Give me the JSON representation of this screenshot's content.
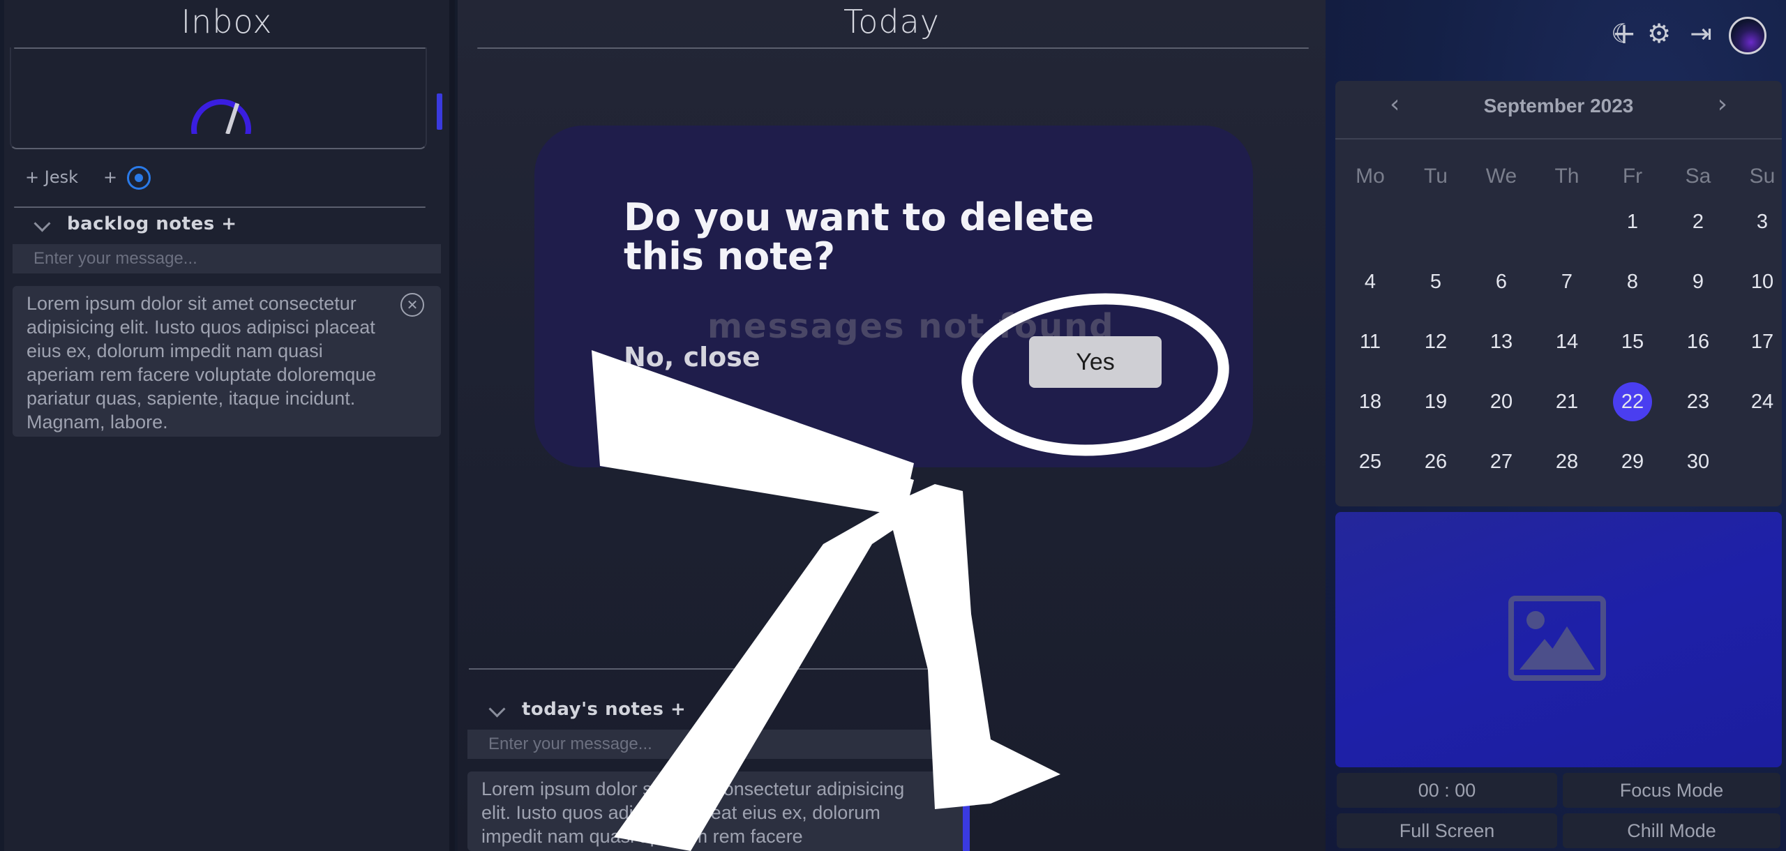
{
  "inbox": {
    "title": "Inbox",
    "add_items": [
      {
        "label": "+ Jesk"
      },
      {
        "label": "+"
      }
    ],
    "backlog": {
      "heading": "backlog notes +",
      "placeholder": "Enter your message...",
      "note": "Lorem ipsum dolor sit amet consectetur adipisicing elit. Iusto quos adipisci placeat eius ex, dolorum impedit nam quasi aperiam rem facere voluptate doloremque pariatur quas, sapiente, itaque incidunt. Magnam, labore."
    }
  },
  "today": {
    "title": "Today",
    "notes_heading": "today's notes +",
    "placeholder": "Enter your message...",
    "note": "Lorem ipsum dolor sit amet consectetur adipisicing elit. Iusto quos adipisci placeat eius ex, dolorum impedit nam quasi aperiam rem facere"
  },
  "modal": {
    "title": "Do you want to delete this note?",
    "background_text": "messages not found",
    "no_label": "No, close",
    "yes_label": "Yes"
  },
  "topbar": {
    "icons": [
      "moon-icon",
      "plus-icon",
      "gear-icon",
      "logout-icon",
      "avatar"
    ]
  },
  "calendar": {
    "month": "September 2023",
    "weekdays": [
      "Mo",
      "Tu",
      "We",
      "Th",
      "Fr",
      "Sa",
      "Su"
    ],
    "weeks": [
      [
        "",
        "",
        "",
        "",
        "1",
        "2",
        "3"
      ],
      [
        "4",
        "5",
        "6",
        "7",
        "8",
        "9",
        "10"
      ],
      [
        "11",
        "12",
        "13",
        "14",
        "15",
        "16",
        "17"
      ],
      [
        "18",
        "19",
        "20",
        "21",
        "22",
        "23",
        "24"
      ],
      [
        "25",
        "26",
        "27",
        "28",
        "29",
        "30",
        ""
      ]
    ],
    "selected": "22"
  },
  "footer": {
    "timer": "00 : 00",
    "focus": "Focus Mode",
    "fullscreen": "Full Screen",
    "chill": "Chill Mode"
  },
  "colors": {
    "accent": "#4a3ef0",
    "modal_bg": "#1f1d4b",
    "image_panel": "#1e20a8"
  }
}
